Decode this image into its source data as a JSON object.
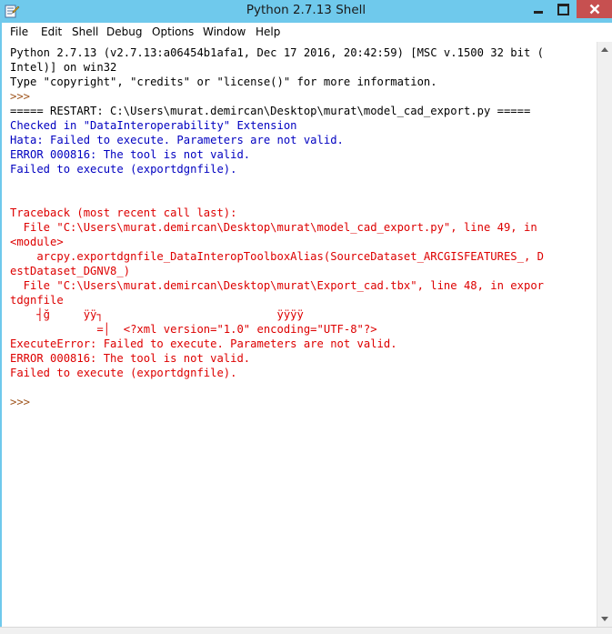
{
  "window": {
    "title": "Python 2.7.13 Shell",
    "colors": {
      "titlebar": "#6fc9ec",
      "close": "#c75050"
    }
  },
  "menubar": {
    "items": [
      "File",
      "Edit",
      "Shell",
      "Debug",
      "Options",
      "Window",
      "Help"
    ]
  },
  "shell": {
    "colors": {
      "output": "#000000",
      "prompt": "#a0561e",
      "stdout": "#0000c0",
      "stderr": "#dd0000"
    },
    "lines": [
      "Python 2.7.13 (v2.7.13:a06454b1afa1, Dec 17 2016, 20:42:59) [MSC v.1500 32 bit (",
      "Intel)] on win32",
      "Type \"copyright\", \"credits\" or \"license()\" for more information.",
      ">>> ",
      "===== RESTART: C:\\Users\\murat.demircan\\Desktop\\murat\\model_cad_export.py =====",
      "Checked in \"DataInteroperability\" Extension",
      "Hata: Failed to execute. Parameters are not valid.",
      "ERROR 000816: The tool is not valid.",
      "Failed to execute (exportdgnfile).",
      "",
      "",
      "Traceback (most recent call last):",
      "  File \"C:\\Users\\murat.demircan\\Desktop\\murat\\model_cad_export.py\", line 49, in ",
      "<module>",
      "    arcpy.exportdgnfile_DataInteropToolboxAlias(SourceDataset_ARCGISFEATURES_, D",
      "estDataset_DGNV8_)",
      "  File \"C:\\Users\\murat.demircan\\Desktop\\murat\\Export_cad.tbx\", line 48, in expor",
      "tdgnfile",
      "    ┤ğ     ÿÿ┐                          ÿÿÿÿ",
      "             =│  <?xml version=\"1.0\" encoding=\"UTF-8\"?>",
      "ExecuteError: Failed to execute. Parameters are not valid.",
      "ERROR 000816: The tool is not valid.",
      "Failed to execute (exportdgnfile).",
      "",
      ">>> "
    ]
  }
}
